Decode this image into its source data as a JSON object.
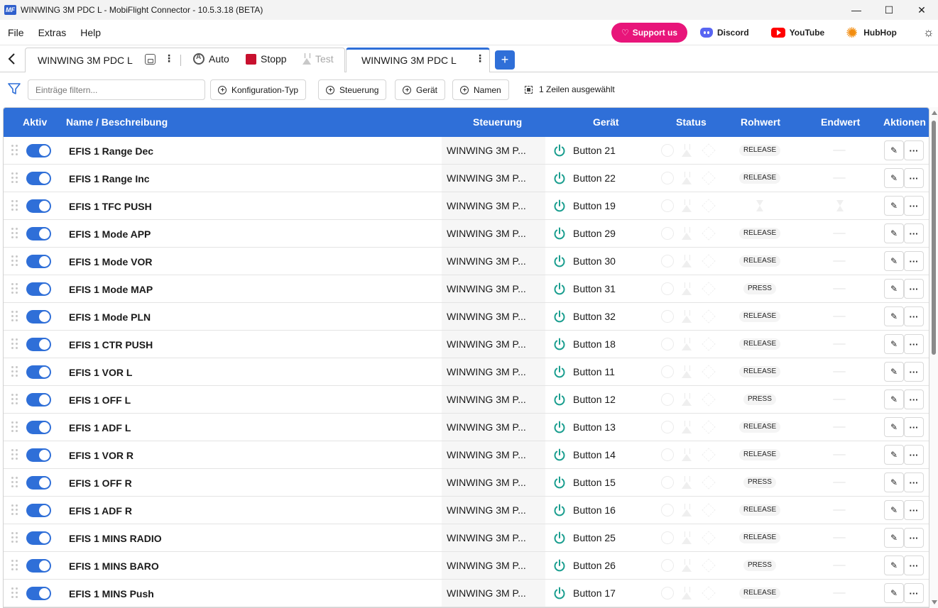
{
  "window": {
    "logo": "MF",
    "title": "WINWING 3M PDC L - MobiFlight Connector - 10.5.3.18 (BETA)",
    "minimize": "—",
    "maximize": "☐",
    "close": "✕"
  },
  "menu": {
    "items": [
      "File",
      "Extras",
      "Help"
    ],
    "support_label": "Support us",
    "discord_label": "Discord",
    "youtube_label": "YouTube",
    "hubhop_label": "HubHop",
    "theme_icon": "☼"
  },
  "tabs": {
    "back": "‹",
    "tab1_title": "WINWING 3M PDC L",
    "kebab": "⋮",
    "auto_label": "Auto",
    "stop_label": "Stopp",
    "test_label": "Test",
    "tab2_title": "WINWING 3M PDC L",
    "add": "+"
  },
  "filters": {
    "placeholder": "Einträge filtern...",
    "chips": [
      "Konfiguration-Typ",
      "Steuerung",
      "Gerät",
      "Namen"
    ],
    "selection_info": "1 Zeilen ausgewählt"
  },
  "table": {
    "headers": {
      "aktiv": "Aktiv",
      "name": "Name / Beschreibung",
      "steuerung": "Steuerung",
      "geraet": "Gerät",
      "status": "Status",
      "rohwert": "Rohwert",
      "endwert": "Endwert",
      "aktionen": "Aktionen"
    },
    "edit_icon": "✎",
    "more_icon": "···",
    "rows": [
      {
        "active": true,
        "name": "EFIS 1 Range Dec",
        "steuerung": "WINWING 3M P...",
        "geraet": "Button 21",
        "rohwert": "RELEASE"
      },
      {
        "active": true,
        "name": "EFIS 1 Range Inc",
        "steuerung": "WINWING 3M P...",
        "geraet": "Button 22",
        "rohwert": "RELEASE"
      },
      {
        "active": true,
        "name": "EFIS 1 TFC PUSH",
        "steuerung": "WINWING 3M P...",
        "geraet": "Button 19",
        "rohwert": ""
      },
      {
        "active": true,
        "name": "EFIS 1 Mode APP",
        "steuerung": "WINWING 3M P...",
        "geraet": "Button 29",
        "rohwert": "RELEASE"
      },
      {
        "active": true,
        "name": "EFIS 1 Mode VOR",
        "steuerung": "WINWING 3M P...",
        "geraet": "Button 30",
        "rohwert": "RELEASE"
      },
      {
        "active": true,
        "name": "EFIS 1 Mode MAP",
        "steuerung": "WINWING 3M P...",
        "geraet": "Button 31",
        "rohwert": "PRESS"
      },
      {
        "active": true,
        "name": "EFIS 1 Mode PLN",
        "steuerung": "WINWING 3M P...",
        "geraet": "Button 32",
        "rohwert": "RELEASE"
      },
      {
        "active": true,
        "name": "EFIS 1 CTR PUSH",
        "steuerung": "WINWING 3M P...",
        "geraet": "Button 18",
        "rohwert": "RELEASE"
      },
      {
        "active": true,
        "name": "EFIS 1 VOR L",
        "steuerung": "WINWING 3M P...",
        "geraet": "Button 11",
        "rohwert": "RELEASE"
      },
      {
        "active": true,
        "name": "EFIS 1 OFF L",
        "steuerung": "WINWING 3M P...",
        "geraet": "Button 12",
        "rohwert": "PRESS"
      },
      {
        "active": true,
        "name": "EFIS 1 ADF L",
        "steuerung": "WINWING 3M P...",
        "geraet": "Button 13",
        "rohwert": "RELEASE"
      },
      {
        "active": true,
        "name": "EFIS 1 VOR R",
        "steuerung": "WINWING 3M P...",
        "geraet": "Button 14",
        "rohwert": "RELEASE"
      },
      {
        "active": true,
        "name": "EFIS 1 OFF R",
        "steuerung": "WINWING 3M P...",
        "geraet": "Button 15",
        "rohwert": "PRESS"
      },
      {
        "active": true,
        "name": "EFIS 1 ADF R",
        "steuerung": "WINWING 3M P...",
        "geraet": "Button 16",
        "rohwert": "RELEASE"
      },
      {
        "active": true,
        "name": "EFIS 1 MINS RADIO",
        "steuerung": "WINWING 3M P...",
        "geraet": "Button 25",
        "rohwert": "RELEASE"
      },
      {
        "active": true,
        "name": "EFIS 1 MINS BARO",
        "steuerung": "WINWING 3M P...",
        "geraet": "Button 26",
        "rohwert": "PRESS"
      },
      {
        "active": true,
        "name": "EFIS 1 MINS Push",
        "steuerung": "WINWING 3M P...",
        "geraet": "Button 17",
        "rohwert": "RELEASE"
      }
    ]
  },
  "colors": {
    "accent": "#2f6fd8",
    "support": "#e8157a",
    "stop": "#c8102e",
    "power_icon": "#1a9e8f"
  }
}
